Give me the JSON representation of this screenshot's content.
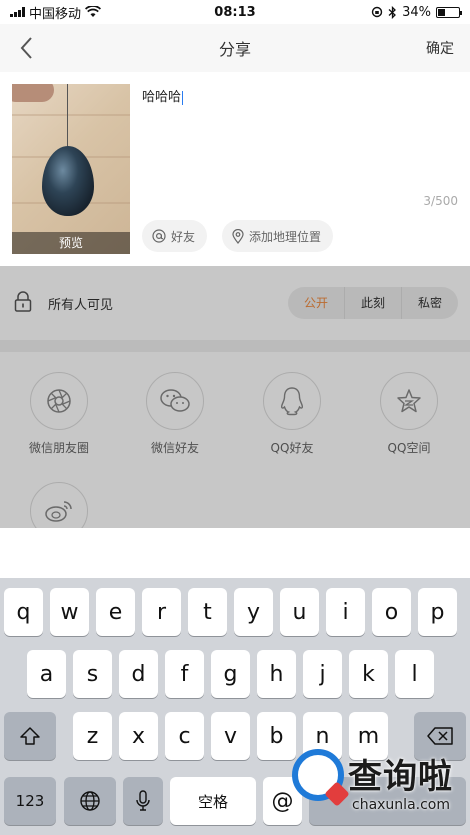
{
  "status_bar": {
    "carrier": "中国移动",
    "time": "08:13",
    "battery": "34%",
    "battery_level": 0.34
  },
  "nav": {
    "title": "分享",
    "confirm_label": "确定"
  },
  "compose": {
    "text": "哈哈哈",
    "preview_label": "预览",
    "char_count": "3/500",
    "friends_chip": "好友",
    "location_chip": "添加地理位置"
  },
  "privacy": {
    "label": "所有人可见",
    "options": [
      "公开",
      "此刻",
      "私密"
    ],
    "selected": "公开",
    "accent_color": "#f08a3e"
  },
  "share_targets": [
    {
      "label": "微信朋友圈",
      "icon": "wechat-moments-icon"
    },
    {
      "label": "微信好友",
      "icon": "wechat-icon"
    },
    {
      "label": "QQ好友",
      "icon": "qq-icon"
    },
    {
      "label": "QQ空间",
      "icon": "qzone-icon"
    },
    {
      "label": "",
      "icon": "weibo-icon"
    }
  ],
  "keyboard": {
    "row1": [
      "q",
      "w",
      "e",
      "r",
      "t",
      "y",
      "u",
      "i",
      "o",
      "p"
    ],
    "row2": [
      "a",
      "s",
      "d",
      "f",
      "g",
      "h",
      "j",
      "k",
      "l"
    ],
    "row3": [
      "z",
      "x",
      "c",
      "v",
      "b",
      "n",
      "m"
    ],
    "numbers_key": "123",
    "space_key": "空格",
    "at_key": "@"
  },
  "watermark": {
    "title": "查询啦",
    "subtitle": "chaxunla.com"
  }
}
